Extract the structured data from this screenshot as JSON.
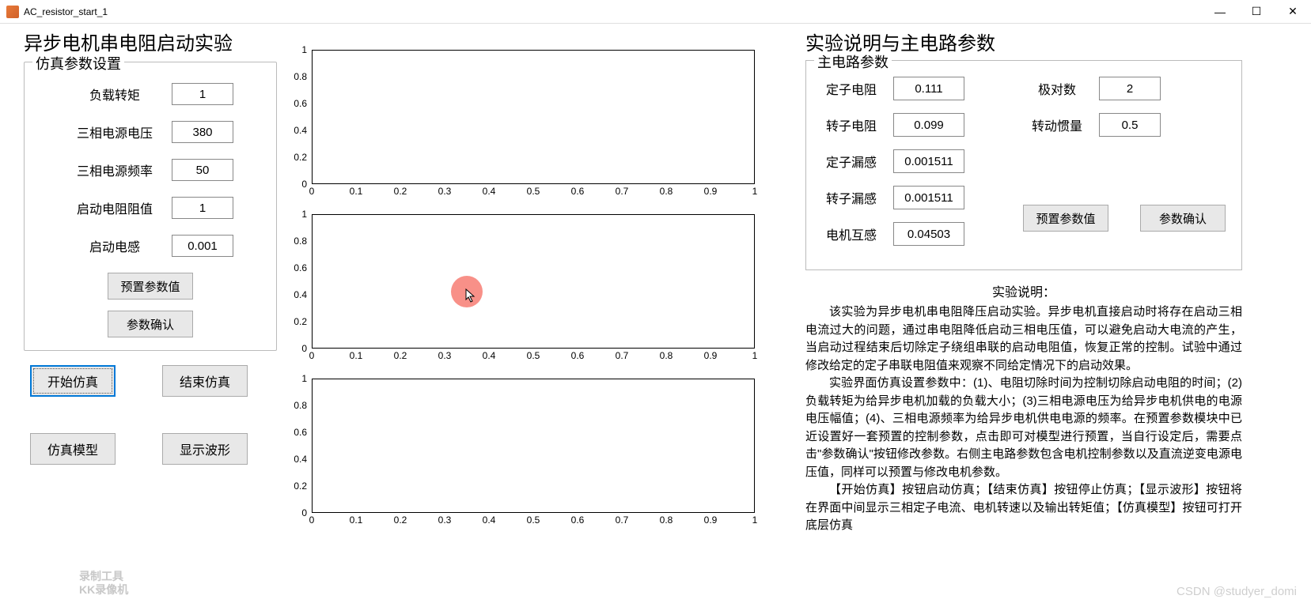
{
  "window": {
    "title": "AC_resistor_start_1",
    "controls": {
      "min": "—",
      "max": "☐",
      "close": "✕"
    }
  },
  "left": {
    "title": "异步电机串电阻启动实验",
    "group_title": "仿真参数设置",
    "params": [
      {
        "label": "负载转矩",
        "value": "1"
      },
      {
        "label": "三相电源电压",
        "value": "380"
      },
      {
        "label": "三相电源频率",
        "value": "50"
      },
      {
        "label": "启动电阻阻值",
        "value": "1"
      },
      {
        "label": "启动电感",
        "value": "0.001"
      }
    ],
    "preset_btn": "预置参数值",
    "confirm_btn": "参数确认",
    "action_btns": {
      "start": "开始仿真",
      "stop": "结束仿真",
      "model": "仿真模型",
      "wave": "显示波形"
    }
  },
  "right": {
    "title": "实验说明与主电路参数",
    "group_title": "主电路参数",
    "params_left": [
      {
        "label": "定子电阻",
        "value": "0.111"
      },
      {
        "label": "转子电阻",
        "value": "0.099"
      },
      {
        "label": "定子漏感",
        "value": "0.001511"
      },
      {
        "label": "转子漏感",
        "value": "0.001511"
      },
      {
        "label": "电机互感",
        "value": "0.04503"
      }
    ],
    "params_right": [
      {
        "label": "极对数",
        "value": "2"
      },
      {
        "label": "转动惯量",
        "value": "0.5"
      }
    ],
    "preset_btn": "预置参数值",
    "confirm_btn": "参数确认",
    "desc_title": "实验说明：",
    "desc_body": "该实验为异步电机串电阻降压启动实验。异步电机直接启动时将存在启动三相电流过大的问题，通过串电阻降低启动三相电压值，可以避免启动大电流的产生，当启动过程结束后切除定子绕组串联的启动电阻值，恢复正常的控制。试验中通过修改给定的定子串联电阻值来观察不同给定情况下的启动效果。\n实验界面仿真设置参数中：(1)、电阻切除时间为控制切除启动电阻的时间；(2)负载转矩为给异步电机加载的负载大小；(3)三相电源电压为给异步电机供电的电源电压幅值；(4)、三相电源频率为给异步电机供电电源的频率。在预置参数模块中已近设置好一套预置的控制参数，点击即可对模型进行预置，当自行设定后，需要点击\"参数确认\"按钮修改参数。右侧主电路参数包含电机控制参数以及直流逆变电源电压值，同样可以预置与修改电机参数。\n【开始仿真】按钮启动仿真；【结束仿真】按钮停止仿真；【显示波形】按钮将在界面中间显示三相定子电流、电机转速以及输出转矩值；【仿真模型】按钮可打开底层仿真"
  },
  "chart_data": [
    {
      "type": "line",
      "series": [],
      "xlim": [
        0,
        1
      ],
      "ylim": [
        0,
        1
      ],
      "xticks": [
        0,
        0.1,
        0.2,
        0.3,
        0.4,
        0.5,
        0.6,
        0.7,
        0.8,
        0.9,
        1
      ],
      "yticks": [
        0,
        0.2,
        0.4,
        0.6,
        0.8,
        1
      ]
    },
    {
      "type": "line",
      "series": [],
      "xlim": [
        0,
        1
      ],
      "ylim": [
        0,
        1
      ],
      "xticks": [
        0,
        0.1,
        0.2,
        0.3,
        0.4,
        0.5,
        0.6,
        0.7,
        0.8,
        0.9,
        1
      ],
      "yticks": [
        0,
        0.2,
        0.4,
        0.6,
        0.8,
        1
      ]
    },
    {
      "type": "line",
      "series": [],
      "xlim": [
        0,
        1
      ],
      "ylim": [
        0,
        1
      ],
      "xticks": [
        0,
        0.1,
        0.2,
        0.3,
        0.4,
        0.5,
        0.6,
        0.7,
        0.8,
        0.9,
        1
      ],
      "yticks": [
        0,
        0.2,
        0.4,
        0.6,
        0.8,
        1
      ]
    }
  ],
  "watermark": {
    "line1": "录制工具",
    "line2": "KK录像机",
    "csdn": "CSDN @studyer_domi"
  }
}
